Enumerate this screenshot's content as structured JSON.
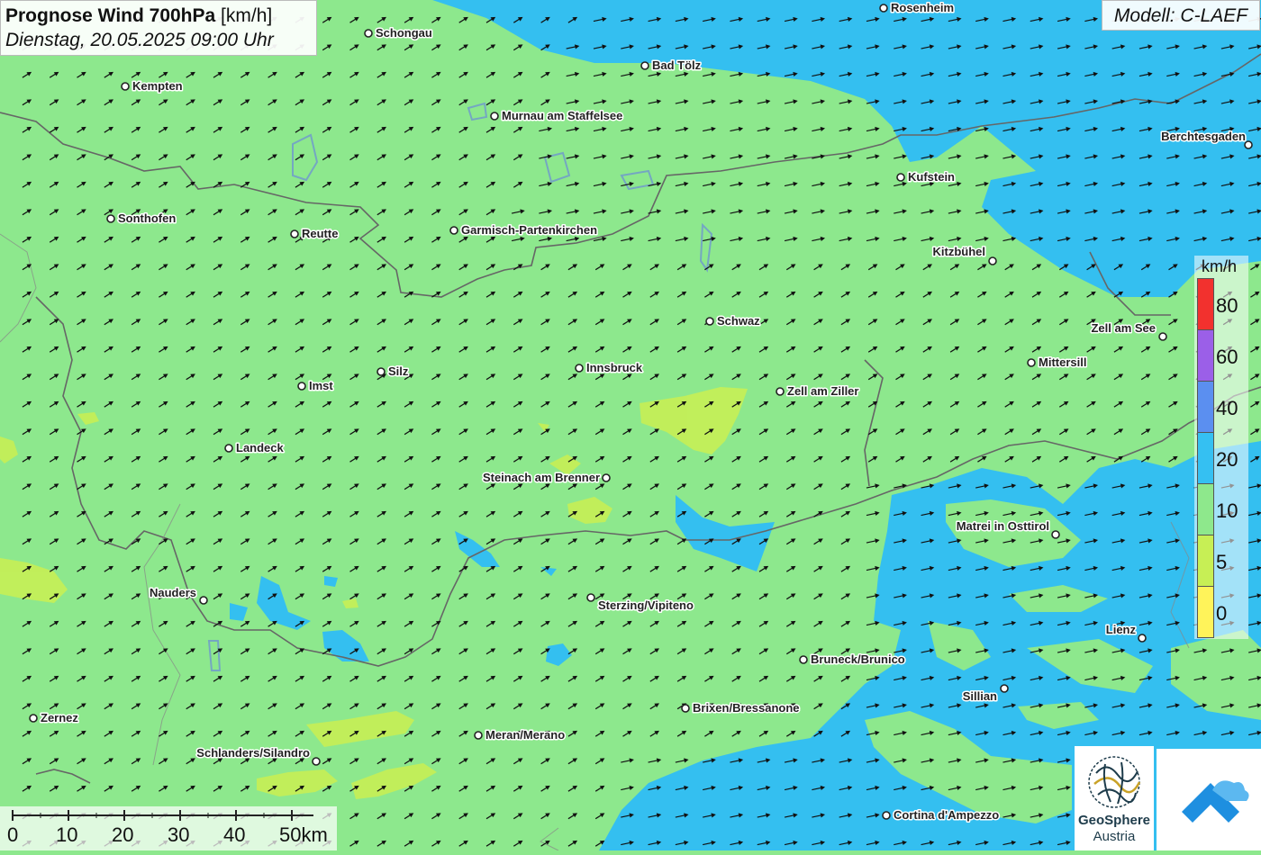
{
  "title": {
    "main": "Prognose Wind 700hPa",
    "unit": "[km/h]",
    "subtitle": "Dienstag, 20.05.2025 09:00 Uhr"
  },
  "model": "Modell: C-LAEF",
  "legend": {
    "unit": "km/h",
    "labels": [
      "80",
      "60",
      "40",
      "20",
      "10",
      "5",
      "0"
    ],
    "colors": [
      "#f2312e",
      "#9b5fe8",
      "#5b8ff0",
      "#35c0f2",
      "#8ee88c",
      "#c7ef55",
      "#fff35a"
    ]
  },
  "scalebar": {
    "labels": [
      "0",
      "10",
      "20",
      "30",
      "40",
      "50km"
    ]
  },
  "cities": [
    {
      "name": "Rosenheim"
    },
    {
      "name": "Schongau"
    },
    {
      "name": "Bad Tölz"
    },
    {
      "name": "Kempten"
    },
    {
      "name": "Murnau am Staffelsee"
    },
    {
      "name": "Berchtesgaden"
    },
    {
      "name": "Kufstein"
    },
    {
      "name": "Sonthofen"
    },
    {
      "name": "Reutte"
    },
    {
      "name": "Garmisch-Partenkirchen"
    },
    {
      "name": "Kitzbühel"
    },
    {
      "name": "Schwaz"
    },
    {
      "name": "Zell am See"
    },
    {
      "name": "Mittersill"
    },
    {
      "name": "Silz"
    },
    {
      "name": "Innsbruck"
    },
    {
      "name": "Imst"
    },
    {
      "name": "Zell am Ziller"
    },
    {
      "name": "Landeck"
    },
    {
      "name": "Steinach am Brenner"
    },
    {
      "name": "Matrei in Osttirol"
    },
    {
      "name": "Nauders"
    },
    {
      "name": "Sterzing/Vipiteno"
    },
    {
      "name": "Lienz"
    },
    {
      "name": "Bruneck/Brunico"
    },
    {
      "name": "Sillian"
    },
    {
      "name": "Brixen/Bressanone"
    },
    {
      "name": "Zernez"
    },
    {
      "name": "Meran/Merano"
    },
    {
      "name": "Schlanders/Silandro"
    },
    {
      "name": "Cortina d'Ampezzo"
    }
  ],
  "logos": {
    "geosphere_line1": "GeoSphere",
    "geosphere_line2": "Austria"
  },
  "colors": {
    "wind_arrow": "#111111",
    "border": "#666666"
  }
}
